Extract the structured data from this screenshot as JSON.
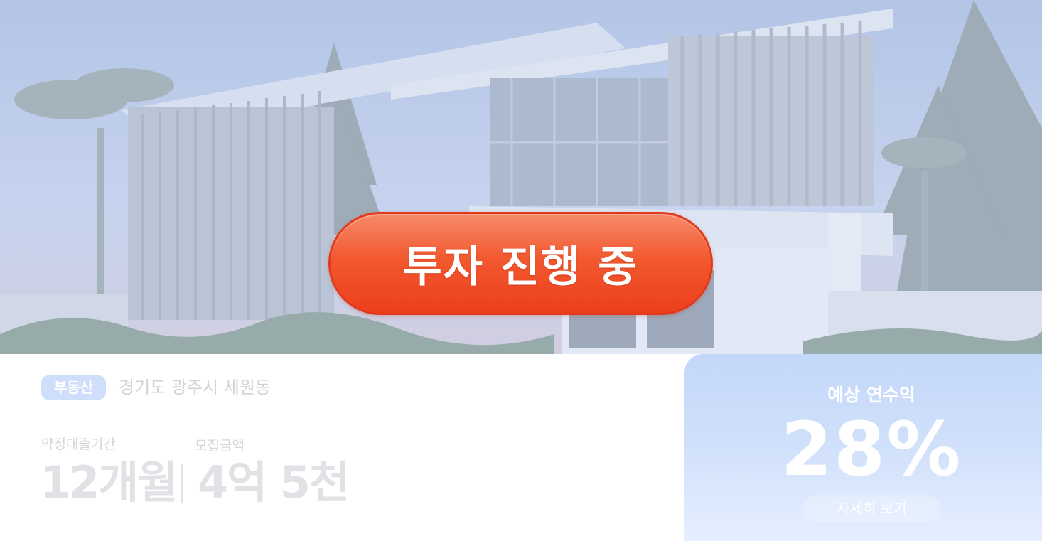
{
  "status": {
    "label": "투자 진행 중"
  },
  "info": {
    "category": "부동산",
    "location": "경기도 광주시 세원동",
    "term_label": "약정대출기간",
    "term_value": "12개월",
    "amount_label": "모집금액",
    "amount_value": "4억 5천"
  },
  "yield": {
    "label": "예상 연수익",
    "value": "28%",
    "details_label": "자세히 보기"
  },
  "colors": {
    "status_accent": "#f2592f",
    "badge_background": "#cfdefa",
    "yield_panel": "#c3d7f9"
  },
  "icons": [
    "building-illustration"
  ]
}
